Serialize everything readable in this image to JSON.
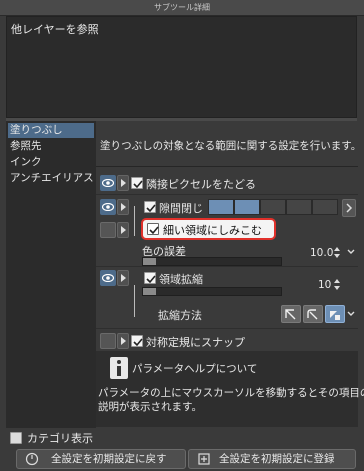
{
  "window": {
    "title": "サブツール詳細"
  },
  "preview": {
    "title": "他レイヤーを参照"
  },
  "categories": [
    {
      "label": "塗りつぶし",
      "selected": true
    },
    {
      "label": "参照先",
      "selected": false
    },
    {
      "label": "インク",
      "selected": false
    },
    {
      "label": "アンチエイリアス",
      "selected": false
    }
  ],
  "category_toggle": {
    "label": "カテゴリ表示",
    "checked": false
  },
  "description": "塗りつぶしの対象となる範囲に関する設定を行います。",
  "settings": {
    "adjacent": {
      "label": "隣接ピクセルをたどる",
      "checked": true
    },
    "gap_close": {
      "label": "隙間閉じ",
      "checked": true,
      "level": 2,
      "levels": 5
    },
    "fine_area": {
      "label": "細い領域にしみこむ",
      "checked": true
    },
    "color_margin": {
      "label": "色の誤差",
      "value": "10.0"
    },
    "area_scale": {
      "label": "領域拡縮",
      "checked": true,
      "value": "10"
    },
    "scale_method": {
      "label": "拡縮方法"
    },
    "symmetry_snap": {
      "label": "対称定規にスナップ",
      "checked": true
    }
  },
  "help": {
    "icon": "info-icon",
    "title": "パラメータヘルプについて",
    "body_line1": "パラメータの上にマウスカーソルを移動するとその項目の",
    "body_line2": "説明が表示されます。"
  },
  "buttons": {
    "reset": "全設定を初期設定に戻す",
    "register": "全設定を初期設定に登録"
  },
  "colors": {
    "accent": "#4d6b8a",
    "highlight": "#e0302a"
  }
}
